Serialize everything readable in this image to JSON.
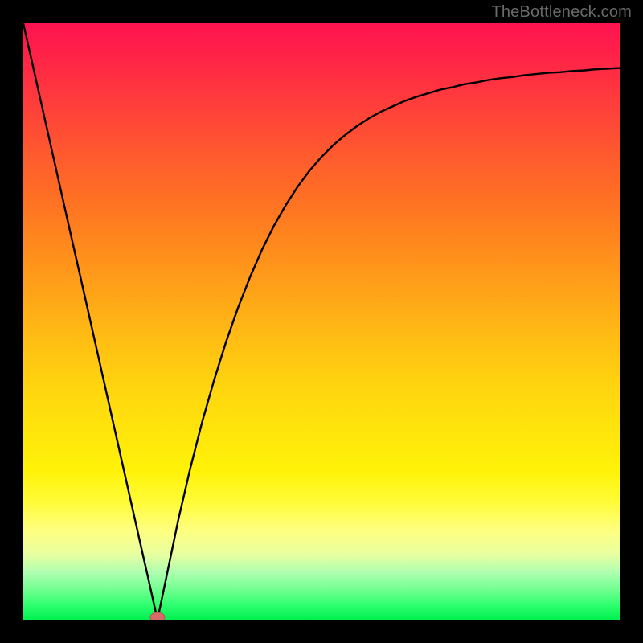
{
  "watermark": "TheBottleneck.com",
  "colors": {
    "curve": "#000000",
    "marker_fill": "#d86a6a",
    "marker_stroke": "#b94a4a",
    "background_frame": "#000000"
  },
  "chart_data": {
    "type": "line",
    "title": "",
    "xlabel": "",
    "ylabel": "",
    "xlim": [
      0,
      1
    ],
    "ylim": [
      0,
      1
    ],
    "x": [
      0.0,
      0.02,
      0.04,
      0.06,
      0.08,
      0.1,
      0.12,
      0.14,
      0.16,
      0.18,
      0.2,
      0.21,
      0.22,
      0.225,
      0.23,
      0.24,
      0.26,
      0.28,
      0.3,
      0.32,
      0.34,
      0.36,
      0.38,
      0.4,
      0.42,
      0.44,
      0.46,
      0.48,
      0.5,
      0.52,
      0.54,
      0.56,
      0.58,
      0.6,
      0.62,
      0.64,
      0.66,
      0.68,
      0.7,
      0.72,
      0.74,
      0.76,
      0.78,
      0.8,
      0.82,
      0.84,
      0.86,
      0.88,
      0.9,
      0.92,
      0.94,
      0.96,
      0.98,
      1.0
    ],
    "values": [
      1.0,
      0.911,
      0.822,
      0.733,
      0.644,
      0.556,
      0.467,
      0.378,
      0.289,
      0.2,
      0.111,
      0.067,
      0.022,
      0.0,
      0.024,
      0.072,
      0.168,
      0.254,
      0.332,
      0.402,
      0.466,
      0.523,
      0.574,
      0.62,
      0.66,
      0.695,
      0.726,
      0.753,
      0.776,
      0.796,
      0.813,
      0.828,
      0.841,
      0.852,
      0.861,
      0.87,
      0.877,
      0.883,
      0.889,
      0.893,
      0.898,
      0.901,
      0.905,
      0.908,
      0.91,
      0.913,
      0.915,
      0.917,
      0.918,
      0.92,
      0.921,
      0.923,
      0.924,
      0.925
    ],
    "minimum_marker": {
      "x": 0.225,
      "y": 0.0
    },
    "annotations": []
  }
}
